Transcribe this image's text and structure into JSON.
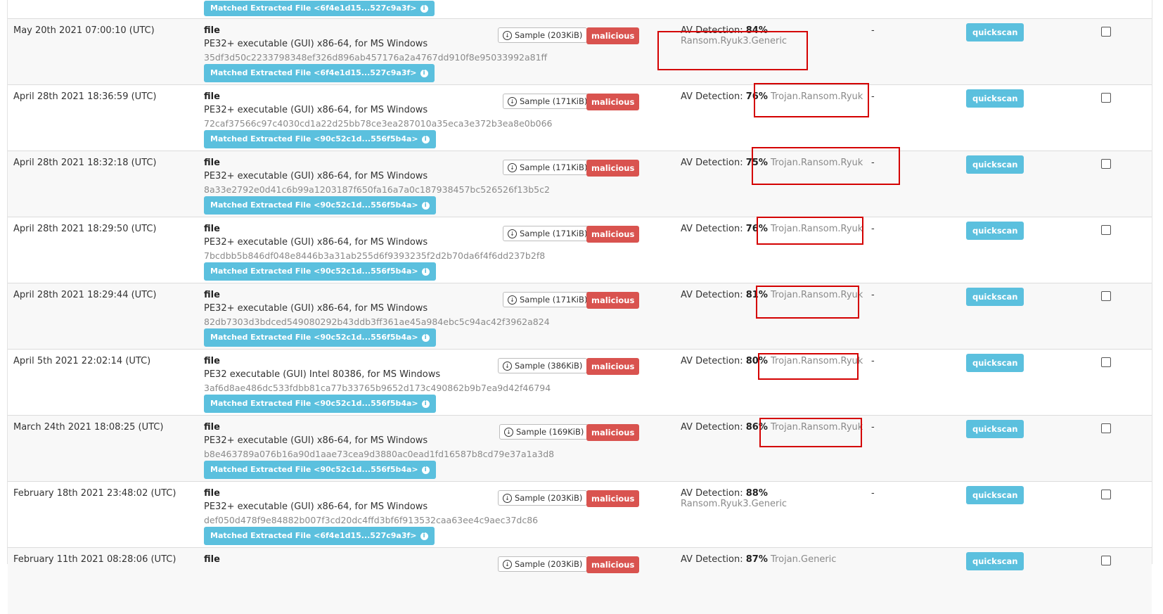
{
  "top_row": {
    "match_label": "Matched Extracted File <6f4e1d15...527c9a3f>"
  },
  "rows": [
    {
      "date": "May 20th 2021 07:00:10 (UTC)",
      "type": "file",
      "description": "PE32+ executable (GUI) x86-64, for MS Windows",
      "hash": "35df3d50c2233798348ef326d896ab457176a2a4767dd910f8e95033992a81ff",
      "match": "Matched Extracted File <6f4e1d15...527c9a3f>",
      "sample": "Sample (203KiB)",
      "verdict": "malicious",
      "av_label": "AV Detection:",
      "av_pct": "84%",
      "av_name": "Ransom.Ryuk3.Generic",
      "dash": "-",
      "quickscan": "quickscan"
    },
    {
      "date": "April 28th 2021 18:36:59 (UTC)",
      "type": "file",
      "description": "PE32+ executable (GUI) x86-64, for MS Windows",
      "hash": "72caf37566c97c4030cd1a22d25bb78ce3ea287010a35eca3e372b3ea8e0b066",
      "match": "Matched Extracted File <90c52c1d...556f5b4a>",
      "sample": "Sample (171KiB)",
      "verdict": "malicious",
      "av_label": "AV Detection:",
      "av_pct": "76%",
      "av_name": "Trojan.Ransom.Ryuk",
      "dash": "-",
      "quickscan": "quickscan"
    },
    {
      "date": "April 28th 2021 18:32:18 (UTC)",
      "type": "file",
      "description": "PE32+ executable (GUI) x86-64, for MS Windows",
      "hash": "8a33e2792e0d41c6b99a1203187f650fa16a7a0c187938457bc526526f13b5c2",
      "match": "Matched Extracted File <90c52c1d...556f5b4a>",
      "sample": "Sample (171KiB)",
      "verdict": "malicious",
      "av_label": "AV Detection:",
      "av_pct": "75%",
      "av_name": "Trojan.Ransom.Ryuk",
      "dash": "-",
      "quickscan": "quickscan"
    },
    {
      "date": "April 28th 2021 18:29:50 (UTC)",
      "type": "file",
      "description": "PE32+ executable (GUI) x86-64, for MS Windows",
      "hash": "7bcdbb5b846df048e8446b3a31ab255d6f9393235f2d2b70da6f4f6dd237b2f8",
      "match": "Matched Extracted File <90c52c1d...556f5b4a>",
      "sample": "Sample (171KiB)",
      "verdict": "malicious",
      "av_label": "AV Detection:",
      "av_pct": "76%",
      "av_name": "Trojan.Ransom.Ryuk",
      "dash": "-",
      "quickscan": "quickscan"
    },
    {
      "date": "April 28th 2021 18:29:44 (UTC)",
      "type": "file",
      "description": "PE32+ executable (GUI) x86-64, for MS Windows",
      "hash": "82db7303d3bdced549080292b43ddb3ff361ae45a984ebc5c94ac42f3962a824",
      "match": "Matched Extracted File <90c52c1d...556f5b4a>",
      "sample": "Sample (171KiB)",
      "verdict": "malicious",
      "av_label": "AV Detection:",
      "av_pct": "81%",
      "av_name": "Trojan.Ransom.Ryuk",
      "dash": "-",
      "quickscan": "quickscan"
    },
    {
      "date": "April 5th 2021 22:02:14 (UTC)",
      "type": "file",
      "description": "PE32 executable (GUI) Intel 80386, for MS Windows",
      "hash": "3af6d8ae486dc533fdbb81ca77b33765b9652d173c490862b9b7ea9d42f46794",
      "match": "Matched Extracted File <90c52c1d...556f5b4a>",
      "sample": "Sample (386KiB)",
      "verdict": "malicious",
      "av_label": "AV Detection:",
      "av_pct": "80%",
      "av_name": "Trojan.Ransom.Ryuk",
      "dash": "-",
      "quickscan": "quickscan"
    },
    {
      "date": "March 24th 2021 18:08:25 (UTC)",
      "type": "file",
      "description": "PE32+ executable (GUI) x86-64, for MS Windows",
      "hash": "b8e463789a076b16a90d1aae73cea9d3880ac0ead1fd16587b8cd79e37a1a3d8",
      "match": "Matched Extracted File <90c52c1d...556f5b4a>",
      "sample": "Sample (169KiB)",
      "verdict": "malicious",
      "av_label": "AV Detection:",
      "av_pct": "86%",
      "av_name": "Trojan.Ransom.Ryuk",
      "dash": "-",
      "quickscan": "quickscan"
    },
    {
      "date": "February 18th 2021 23:48:02 (UTC)",
      "type": "file",
      "description": "PE32+ executable (GUI) x86-64, for MS Windows",
      "hash": "def050d478f9e84882b007f3cd20dc4ffd3bf6f913532caa63ee4c9aec37dc86",
      "match": "Matched Extracted File <6f4e1d15...527c9a3f>",
      "sample": "Sample (203KiB)",
      "verdict": "malicious",
      "av_label": "AV Detection:",
      "av_pct": "88%",
      "av_name": "Ransom.Ryuk3.Generic",
      "dash": "-",
      "quickscan": "quickscan"
    },
    {
      "date": "February 11th 2021 08:28:06 (UTC)",
      "type": "file",
      "description": "",
      "hash": "",
      "match": "",
      "sample": "Sample (203KiB)",
      "verdict": "malicious",
      "av_label": "AV Detection:",
      "av_pct": "87%",
      "av_name": "Trojan.Generic",
      "dash": "",
      "quickscan": "quickscan"
    }
  ],
  "colors": {
    "info_blue": "#5bc0de",
    "danger_red": "#d9534f",
    "highlight_red": "#d40000"
  }
}
